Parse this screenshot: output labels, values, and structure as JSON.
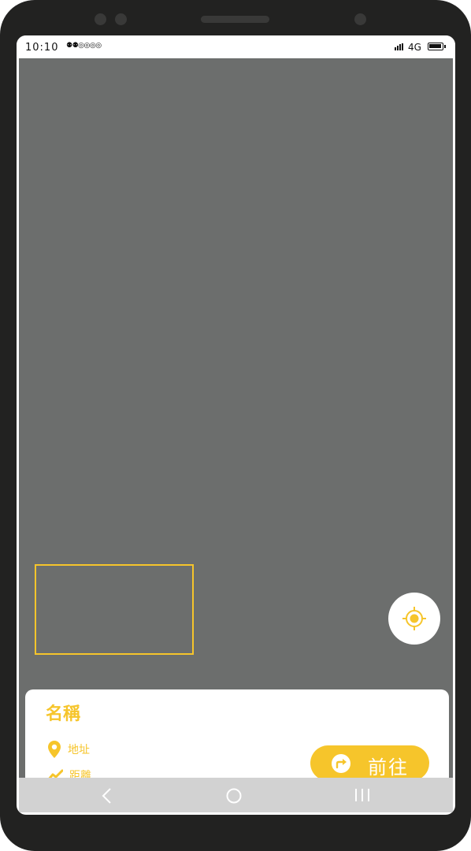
{
  "status_bar": {
    "time": "10:10",
    "notification_icons": "⚉⚉◎◎◎◎",
    "network": "4G"
  },
  "map": {
    "background_color": "#6c6e6d",
    "highlight_color": "#f6c52b"
  },
  "locate_button": {
    "icon": "crosshair-icon"
  },
  "info_card": {
    "name": "名稱",
    "address_label": "地址",
    "distance_label": "距離",
    "go_button_label": "前往",
    "address_icon": "location-pin-icon",
    "distance_icon": "trend-line-icon",
    "go_icon": "turn-right-arrow-icon"
  },
  "nav_bar": {
    "back_icon": "chevron-left-icon",
    "home_icon": "circle-home-icon",
    "recents_icon": "three-bars-icon"
  },
  "colors": {
    "accent": "#f6c52b",
    "phone_frame": "#222221",
    "nav_bar": "#d2d2d2"
  }
}
